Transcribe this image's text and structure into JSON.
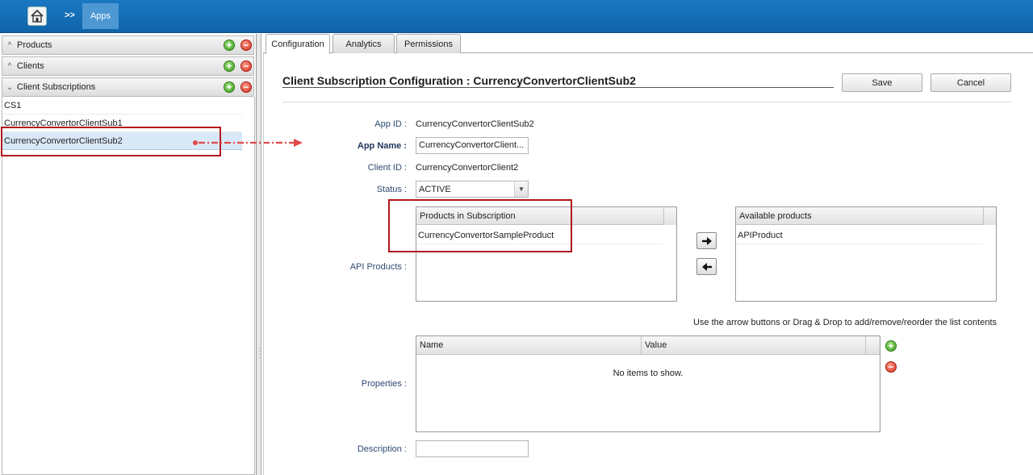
{
  "topbar": {
    "separator": ">>",
    "breadcrumb": "Apps"
  },
  "sidebar": {
    "sections": [
      {
        "label": "Products"
      },
      {
        "label": "Clients"
      },
      {
        "label": "Client Subscriptions"
      }
    ],
    "items": [
      "CS1",
      "CurrencyConvertorClientSub1",
      "CurrencyConvertorClientSub2"
    ],
    "selected_index": 2
  },
  "tabs": [
    "Configuration",
    "Analytics",
    "Permissions"
  ],
  "form": {
    "title": "Client Subscription Configuration : CurrencyConvertorClientSub2",
    "save_label": "Save",
    "cancel_label": "Cancel",
    "app_id_label": "App ID :",
    "app_id": "CurrencyConvertorClientSub2",
    "app_name_label": "App Name :",
    "app_name": "CurrencyConvertorClient...",
    "client_id_label": "Client ID :",
    "client_id": "CurrencyConvertorClient2",
    "status_label": "Status :",
    "status": "ACTIVE",
    "api_products_label": "API Products :",
    "products_in_subscription_header": "Products in Subscription",
    "products_in_subscription": [
      "CurrencyConvertorSampleProduct"
    ],
    "available_products_header": "Available products",
    "available_products": [
      "APIProduct"
    ],
    "hint": "Use the arrow buttons or Drag & Drop to add/remove/reorder the list contents",
    "properties_label": "Properties :",
    "properties_columns": [
      "Name",
      "Value"
    ],
    "properties_empty": "No items to show.",
    "description_label": "Description :",
    "description": ""
  },
  "colors": {
    "topbar": "#1a78c2",
    "highlight_box": "#b3161d",
    "selection": "#d9e8f7"
  }
}
